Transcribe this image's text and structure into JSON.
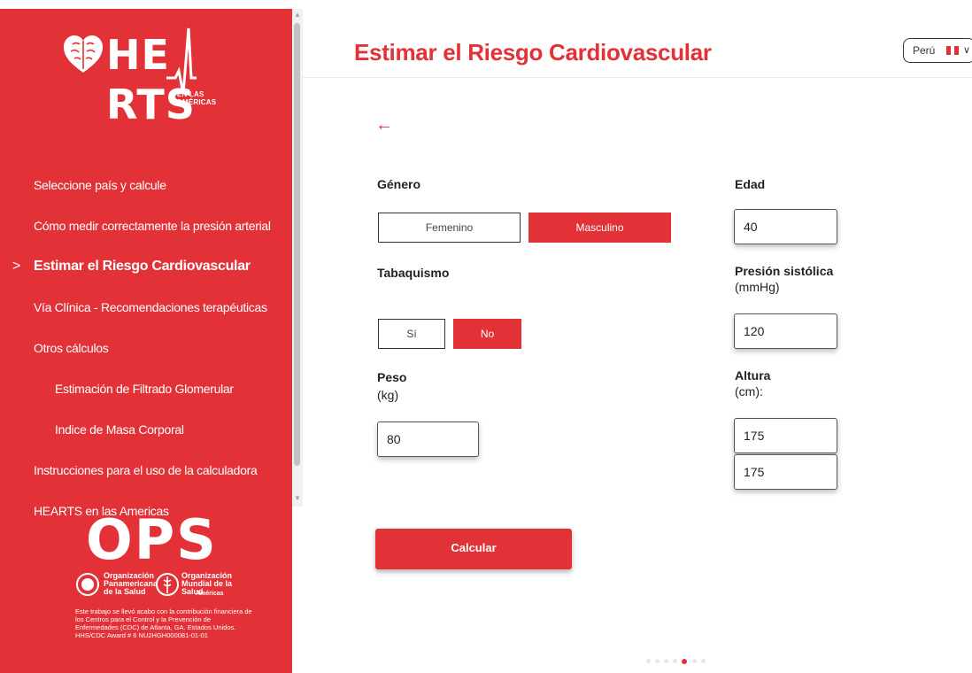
{
  "brand": {
    "logo_text": "HE RTS",
    "logo_sub": "EN LAS AMÉRICAS",
    "ops_text": "OPS",
    "org1": [
      "Organización",
      "Panamericana",
      "de la Salud"
    ],
    "org2": [
      "Organización",
      "Mundial de la Salud",
      "Américas"
    ],
    "credit": "Este trabajo se llevó acabo con la contribución financiera de los Centros para el Control y la Prevención de Enfermedades (CDC) de Atlanta, GA. Estados Unidos. HHS/CDC Award # 6 NU2HGH000081-01-01"
  },
  "sidebar": {
    "items": [
      {
        "label": "Seleccione país y calcule"
      },
      {
        "label": "Cómo medir correctamente la presión arterial"
      },
      {
        "label": "Estimar el Riesgo Cardiovascular",
        "active": true
      },
      {
        "label": "Vía Clínica - Recomendaciones terapéuticas"
      },
      {
        "label": "Otros cálculos"
      },
      {
        "label": "Estimación de Filtrado Glomerular"
      },
      {
        "label": "Indice de Masa Corporal"
      },
      {
        "label": "Instrucciones para el uso de la calculadora"
      },
      {
        "label": "HEARTS en las Americas"
      }
    ],
    "chevron": ">"
  },
  "header": {
    "title": "Estimar el Riesgo Cardiovascular",
    "country": "Perú",
    "caret": "∨"
  },
  "back": "←",
  "form": {
    "genero": {
      "label": "Género",
      "options": [
        "Femenino",
        "Masculino"
      ],
      "selected": "Masculino"
    },
    "tabaquismo": {
      "label": "Tabaquismo",
      "options": [
        "Sí",
        "No"
      ],
      "selected": "No"
    },
    "peso": {
      "label": "Peso",
      "unit": "(kg)",
      "value": "80"
    },
    "edad": {
      "label": "Edad",
      "value": "40"
    },
    "presion": {
      "label": "Presión sistólica",
      "unit": "(mmHg)",
      "value": "120"
    },
    "altura": {
      "label": "Altura",
      "unit": "(cm):",
      "value": "175",
      "suggestion": "175"
    },
    "submit": "Calcular"
  },
  "colors": {
    "accent": "#e23237"
  },
  "pager": {
    "count": 7,
    "active_index": 4
  }
}
